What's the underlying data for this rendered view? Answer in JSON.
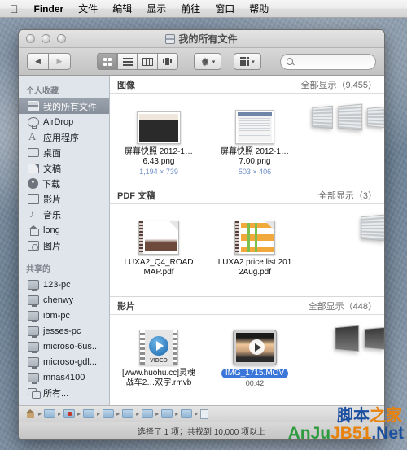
{
  "menubar": {
    "apple": "",
    "items": [
      {
        "label": "Finder",
        "bold": true
      },
      {
        "label": "文件",
        "bold": false
      },
      {
        "label": "编辑",
        "bold": false
      },
      {
        "label": "显示",
        "bold": false
      },
      {
        "label": "前往",
        "bold": false
      },
      {
        "label": "窗口",
        "bold": false
      },
      {
        "label": "帮助",
        "bold": false
      }
    ]
  },
  "window": {
    "title": "我的所有文件",
    "toolbar": {
      "back_glyph": "◀",
      "forward_glyph": "▶",
      "view_icon_label": "icon-view",
      "view_list_label": "list-view",
      "view_column_label": "column-view",
      "view_coverflow_label": "coverflow-view",
      "action_caret": "▾",
      "arrange_caret": "▾"
    },
    "search": {
      "value": "",
      "placeholder": ""
    }
  },
  "sidebar": {
    "sections": [
      {
        "header": "个人收藏",
        "items": [
          {
            "label": "我的所有文件",
            "icon": "all-files-icon",
            "selected": true
          },
          {
            "label": "AirDrop",
            "icon": "airdrop-icon",
            "selected": false
          },
          {
            "label": "应用程序",
            "icon": "applications-icon",
            "selected": false
          },
          {
            "label": "桌面",
            "icon": "desktop-icon",
            "selected": false
          },
          {
            "label": "文稿",
            "icon": "documents-icon",
            "selected": false
          },
          {
            "label": "下载",
            "icon": "downloads-icon",
            "selected": false
          },
          {
            "label": "影片",
            "icon": "movies-icon",
            "selected": false
          },
          {
            "label": "音乐",
            "icon": "music-icon",
            "selected": false
          },
          {
            "label": "long",
            "icon": "home-icon",
            "selected": false
          },
          {
            "label": "图片",
            "icon": "pictures-icon",
            "selected": false
          }
        ]
      },
      {
        "header": "共享的",
        "items": [
          {
            "label": "123-pc",
            "icon": "computer-icon",
            "selected": false
          },
          {
            "label": "chenwy",
            "icon": "computer-icon",
            "selected": false
          },
          {
            "label": "ibm-pc",
            "icon": "computer-icon",
            "selected": false
          },
          {
            "label": "jesses-pc",
            "icon": "computer-icon",
            "selected": false
          },
          {
            "label": "microso-6us...",
            "icon": "computer-icon",
            "selected": false
          },
          {
            "label": "microso-gdl...",
            "icon": "computer-icon",
            "selected": false
          },
          {
            "label": "mnas4100",
            "icon": "computer-icon",
            "selected": false
          },
          {
            "label": "所有...",
            "icon": "all-network-icon",
            "selected": false
          }
        ]
      }
    ]
  },
  "content": {
    "sections": [
      {
        "title": "图像",
        "show_all": "全部显示（9,455）",
        "files": [
          {
            "name": "屏幕快照 2012-1…6.43.png",
            "meta": "1,194 × 739",
            "selected": false,
            "icon": "png-screenshot-thumb"
          },
          {
            "name": "屏幕快照 2012-1…7.00.png",
            "meta": "503 × 406",
            "selected": false,
            "icon": "png-screenshot-thumb"
          }
        ]
      },
      {
        "title": "PDF 文稿",
        "show_all": "全部显示（3）",
        "files": [
          {
            "name": "LUXA2_Q4_ROADMAP.pdf",
            "meta": "",
            "selected": false,
            "icon": "pdf-document-icon"
          },
          {
            "name": "LUXA2 price list 2012Aug.pdf",
            "meta": "",
            "selected": false,
            "icon": "pdf-document-icon"
          }
        ]
      },
      {
        "title": "影片",
        "show_all": "全部显示（448）",
        "files": [
          {
            "name": "[www.huohu.cc]灵魂战车2…双字.rmvb",
            "meta": "",
            "selected": false,
            "icon": "video-filmstrip-icon"
          },
          {
            "name": "IMG_1715.MOV",
            "meta": "00:42",
            "selected": true,
            "icon": "quicktime-movie-icon"
          }
        ]
      }
    ]
  },
  "statusbar": {
    "text": "选择了 1 项；共找到 10,000 项以上"
  },
  "watermark": {
    "line1_a": "脚本",
    "line1_b": "之家",
    "line2_a": "AnJu",
    "line2_b": "JB51",
    "line2_c": ".Net"
  },
  "colors": {
    "selection_blue": "#3b77d8",
    "sidebar_bg": "#e0e5eb",
    "sidebar_selected": "#8d96a2",
    "meta_blue": "#6f8fc7"
  }
}
